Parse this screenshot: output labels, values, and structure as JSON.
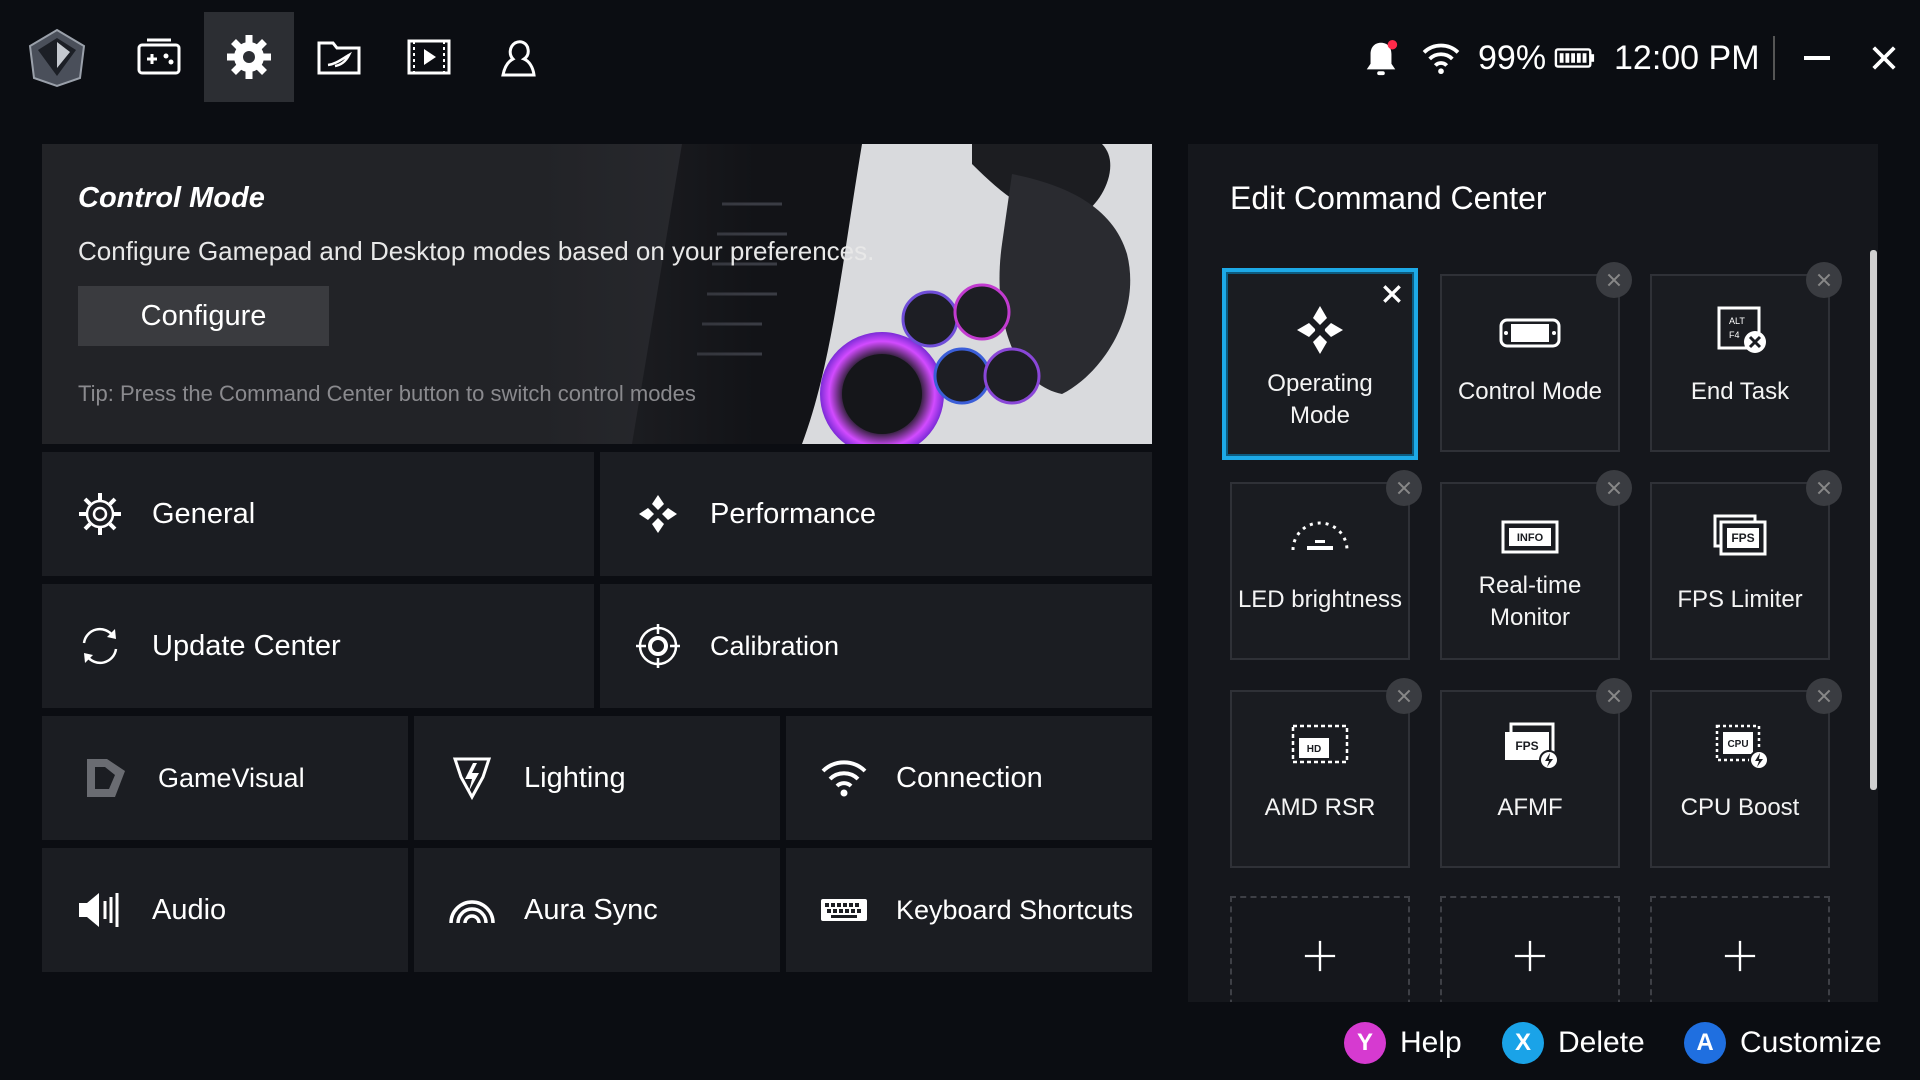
{
  "top_bar": {
    "nav": [
      {
        "name": "game-library-icon"
      },
      {
        "name": "settings-icon",
        "active": true
      },
      {
        "name": "armoury-icon"
      },
      {
        "name": "media-icon"
      },
      {
        "name": "user-icon"
      }
    ],
    "battery_percent": "99%",
    "time": "12:00 PM",
    "minimize_icon": "minimize-icon",
    "close_icon": "close-icon"
  },
  "hero": {
    "title": "Control Mode",
    "description": "Configure Gamepad and Desktop modes based on your preferences.",
    "button_label": "Configure",
    "tip": "Tip: Press the Command Center button to switch control modes"
  },
  "tiles": {
    "general": "General",
    "performance": "Performance",
    "update_center": "Update Center",
    "calibration": "Calibration",
    "gamevisual": "GameVisual",
    "lighting": "Lighting",
    "connection": "Connection",
    "audio": "Audio",
    "aura_sync": "Aura Sync",
    "keyboard_shortcuts": "Keyboard Shortcuts"
  },
  "command_center": {
    "title": "Edit Command Center",
    "cards": [
      {
        "label_line1": "Operating",
        "label_line2": "Mode",
        "icon": "operating-mode-icon",
        "selected": true
      },
      {
        "label_line1": "Control Mode",
        "label_line2": "",
        "icon": "control-mode-icon"
      },
      {
        "label_line1": "End Task",
        "label_line2": "",
        "icon": "end-task-icon"
      },
      {
        "label_line1": "LED brightness",
        "label_line2": "",
        "icon": "led-brightness-icon"
      },
      {
        "label_line1": "Real-time",
        "label_line2": "Monitor",
        "icon": "realtime-monitor-icon"
      },
      {
        "label_line1": "FPS Limiter",
        "label_line2": "",
        "icon": "fps-limiter-icon"
      },
      {
        "label_line1": "AMD RSR",
        "label_line2": "",
        "icon": "amd-rsr-icon"
      },
      {
        "label_line1": "AFMF",
        "label_line2": "",
        "icon": "afmf-icon"
      },
      {
        "label_line1": "CPU Boost",
        "label_line2": "",
        "icon": "cpu-boost-icon"
      }
    ],
    "icon_texts": {
      "info": "INFO",
      "fps": "FPS",
      "hd": "HD",
      "cpu": "CPU",
      "alt": "ALT",
      "f4": "F4"
    }
  },
  "hints": [
    {
      "key": "Y",
      "label": "Help",
      "color": "#d63ad0"
    },
    {
      "key": "X",
      "label": "Delete",
      "color": "#1aa3e8"
    },
    {
      "key": "A",
      "label": "Customize",
      "color": "#1f6fe0"
    }
  ]
}
